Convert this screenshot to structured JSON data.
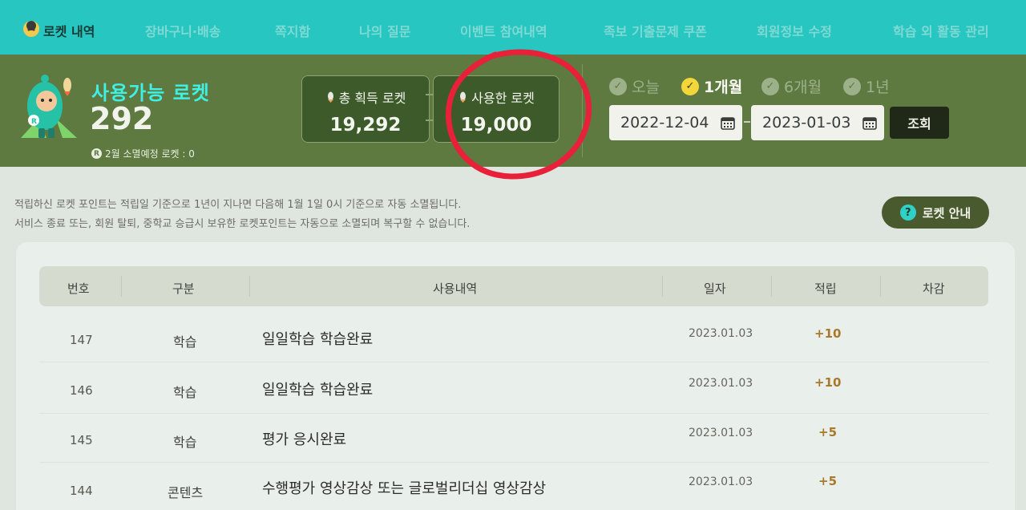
{
  "nav": {
    "title": "로켓 내역",
    "items": [
      "장바구니·배송",
      "쪽지함",
      "나의 질문",
      "이벤트 참여내역",
      "족보 기출문제 쿠폰",
      "회원정보 수정",
      "학습 외 활동 관리"
    ]
  },
  "summary": {
    "available_label": "사용가능 로켓",
    "available_value": "292",
    "expire_note": "2월 소멸예정 로켓 : 0",
    "total_label": "총 획득 로켓",
    "total_value": "19,292",
    "used_label": "사용한 로켓",
    "used_value": "19,000"
  },
  "filter": {
    "periods": [
      "오늘",
      "1개월",
      "6개월",
      "1년"
    ],
    "active_period": "1개월",
    "start_date": "2022-12-04",
    "end_date": "2023-01-03",
    "search_label": "조회"
  },
  "notice": {
    "line1": "적립하신 로켓 포인트는 적립일 기준으로 1년이 지나면 다음해 1월 1일 0시 기준으로 자동 소멸됩니다.",
    "line2": "서비스 종료 또는, 회원 탈퇴, 중학교 승급시 보유한 로켓포인트는 자동으로 소멸되며 복구할 수 없습니다.",
    "guide_label": "로켓 안내"
  },
  "table": {
    "headers": [
      "번호",
      "구분",
      "사용내역",
      "일자",
      "적립",
      "차감"
    ],
    "rows": [
      {
        "no": "147",
        "type": "학습",
        "desc": "일일학습 학습완료",
        "date": "2023.01.03",
        "earn": "+10",
        "deduct": ""
      },
      {
        "no": "146",
        "type": "학습",
        "desc": "일일학습 학습완료",
        "date": "2023.01.03",
        "earn": "+10",
        "deduct": ""
      },
      {
        "no": "145",
        "type": "학습",
        "desc": "평가 응시완료",
        "date": "2023.01.03",
        "earn": "+5",
        "deduct": ""
      },
      {
        "no": "144",
        "type": "콘텐츠",
        "desc": "수행평가 영상감상 또는 글로벌리더십 영상감상",
        "date": "2023.01.03",
        "earn": "+5",
        "deduct": ""
      }
    ]
  },
  "colors": {
    "nav_bg": "#27c6c0",
    "band_bg": "#5f7a40",
    "accent_cyan": "#3ff0e4",
    "points": "#a9782a",
    "annotation": "#e8203a"
  }
}
